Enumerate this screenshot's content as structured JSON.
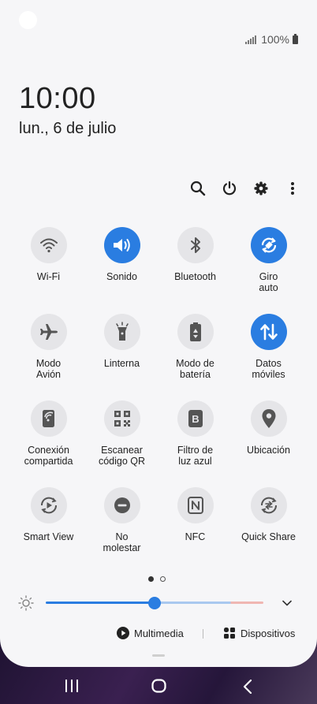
{
  "status": {
    "battery": "100%"
  },
  "clock": {
    "time": "10:00",
    "date": "lun., 6 de julio"
  },
  "toolbar": {
    "icons": [
      "search-icon",
      "power-icon",
      "gear-icon",
      "more-vert-icon"
    ]
  },
  "tiles": [
    {
      "label": "Wi-Fi",
      "on": false,
      "icon": "wifi-icon"
    },
    {
      "label": "Sonido",
      "on": true,
      "icon": "speaker-icon"
    },
    {
      "label": "Bluetooth",
      "on": false,
      "icon": "bluetooth-icon"
    },
    {
      "label": "Giro\nauto",
      "on": true,
      "icon": "rotate-icon"
    },
    {
      "label": "Modo\nAvión",
      "on": false,
      "icon": "airplane-icon"
    },
    {
      "label": "Linterna",
      "on": false,
      "icon": "flashlight-icon"
    },
    {
      "label": "Modo de\nbatería",
      "on": false,
      "icon": "battery-mode-icon"
    },
    {
      "label": "Datos\nmóviles",
      "on": true,
      "icon": "mobile-data-icon"
    },
    {
      "label": "Conexión\ncompartida",
      "on": false,
      "icon": "hotspot-icon"
    },
    {
      "label": "Escanear\ncódigo QR",
      "on": false,
      "icon": "qr-icon"
    },
    {
      "label": "Filtro de\nluz azul",
      "on": false,
      "icon": "blue-light-icon"
    },
    {
      "label": "Ubicación",
      "on": false,
      "icon": "location-icon"
    },
    {
      "label": "Smart View",
      "on": false,
      "icon": "smart-view-icon"
    },
    {
      "label": "No\nmolestar",
      "on": false,
      "icon": "do-not-disturb-icon"
    },
    {
      "label": "NFC",
      "on": false,
      "icon": "nfc-icon"
    },
    {
      "label": "Quick Share",
      "on": false,
      "icon": "quick-share-icon"
    }
  ],
  "pager": {
    "current": 1,
    "total": 2
  },
  "brightness": {
    "level": 0.5
  },
  "bottom": {
    "media_label": "Multimedia",
    "devices_label": "Dispositivos"
  },
  "colors": {
    "accent": "#2a7de1",
    "tile_off": "#e5e5e8",
    "panel": "#f6f6f8"
  }
}
